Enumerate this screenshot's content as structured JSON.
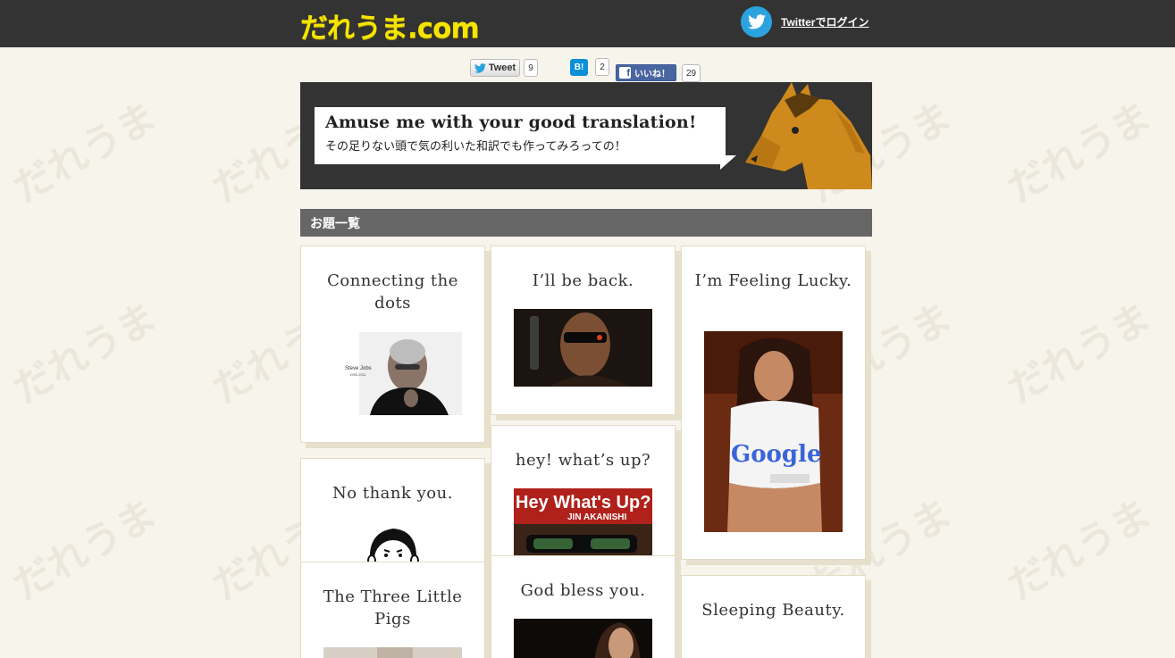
{
  "watermark_text": "だれうま",
  "header": {
    "logo": "だれうま.com",
    "twitter_login": "Twitterでログイン"
  },
  "social": {
    "tweet_label": "Tweet",
    "tweet_count": "9",
    "hatena_label": "B!",
    "hatena_count": "2",
    "fb_label": "いいね！",
    "fb_count": "29"
  },
  "banner": {
    "title": "Amuse me with your good translation!",
    "subtitle": "その足りない頭で気の利いた和訳でも作ってみろっての！"
  },
  "section": {
    "title": "お題一覧"
  },
  "cards": [
    {
      "title": "Connecting the dots",
      "image": "steve-jobs-photo",
      "image_text": "Steve Jobs",
      "image_subtext": "1955-2011"
    },
    {
      "title": "I’ll be back.",
      "image": "terminator-photo"
    },
    {
      "title": "I’m Feeling Lucky.",
      "image": "google-shirt-photo",
      "image_text": "Google"
    },
    {
      "title": "No thank you.",
      "image": "rage-face-drawing"
    },
    {
      "title": "hey! what’s up?",
      "image": "jin-akanishi-cover",
      "image_text": "Hey What's Up?",
      "image_subtext": "JIN AKANISHI"
    },
    {
      "title": "The Three Little Pigs",
      "image": "pigs-photo"
    },
    {
      "title": "God bless you.",
      "image": "portrait-photo"
    },
    {
      "title": "Sleeping Beauty.",
      "image": "none"
    }
  ],
  "colors": {
    "topbar": "#333333",
    "logo": "#f5e400",
    "twitter_blue": "#2aa3df",
    "background": "#f7f4ec",
    "section_head": "#666666",
    "horse": "#cf8a1e"
  }
}
